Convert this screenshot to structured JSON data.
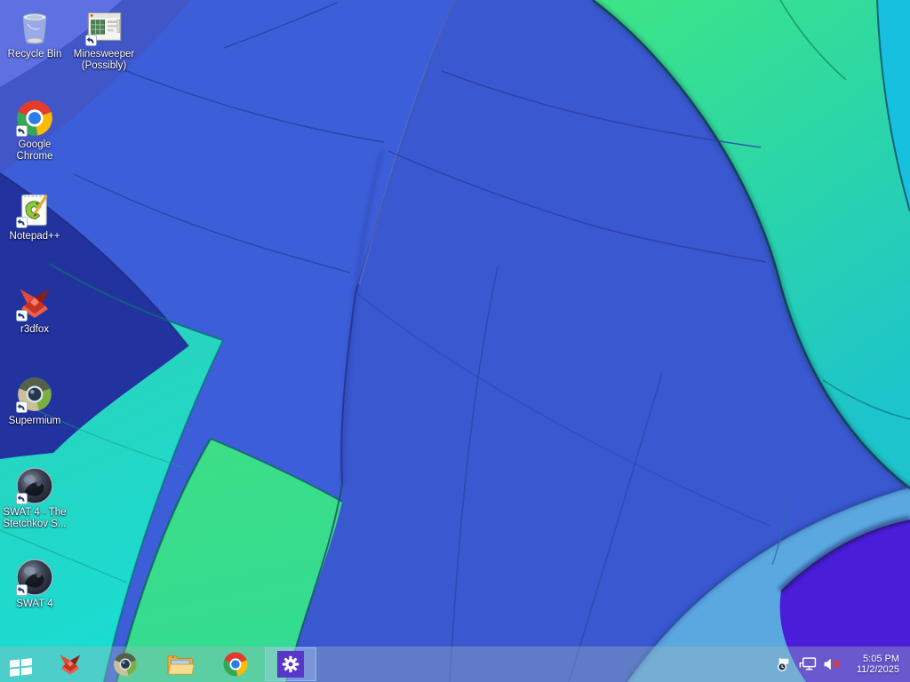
{
  "desktop": {
    "icons": [
      {
        "id": "recycle-bin",
        "label": "Recycle Bin",
        "has_shortcut_arrow": false
      },
      {
        "id": "minesweeper",
        "label": "Minesweeper (Possibly)",
        "has_shortcut_arrow": true
      },
      {
        "id": "google-chrome",
        "label": "Google Chrome",
        "has_shortcut_arrow": true
      },
      {
        "id": "notepad-plus-plus",
        "label": "Notepad++",
        "has_shortcut_arrow": true
      },
      {
        "id": "r3dfox",
        "label": "r3dfox",
        "has_shortcut_arrow": true
      },
      {
        "id": "supermium",
        "label": "Supermium",
        "has_shortcut_arrow": true
      },
      {
        "id": "swat4-stetchkov",
        "label": "SWAT 4 - The Stetchkov S...",
        "has_shortcut_arrow": true
      },
      {
        "id": "swat4",
        "label": "SWAT 4",
        "has_shortcut_arrow": true
      }
    ]
  },
  "taskbar": {
    "buttons": [
      {
        "id": "start",
        "icon": "windows-start-icon",
        "active": false
      },
      {
        "id": "r3dfox",
        "icon": "r3dfox-icon",
        "active": false
      },
      {
        "id": "supermium",
        "icon": "supermium-icon",
        "active": false
      },
      {
        "id": "file-explorer",
        "icon": "file-explorer-icon",
        "active": false
      },
      {
        "id": "google-chrome",
        "icon": "chrome-icon",
        "active": false
      },
      {
        "id": "settings",
        "icon": "settings-gear-icon",
        "active": true
      }
    ],
    "tray": {
      "icons": [
        "action-center-flag-icon",
        "network-wired-icon",
        "volume-muted-icon"
      ],
      "time": "5:05 PM",
      "date": "11/2/2025"
    }
  },
  "colors": {
    "settings_tile": "#5836c9",
    "active_button_highlight": "rgba(190,220,250,0.28)",
    "label_text": "#ffffff",
    "wallpaper_palette": [
      "#3c5fd9",
      "#3a58d0",
      "#5e70e2",
      "#4157c8",
      "#22339f",
      "#2ed0b4",
      "#3ddf86",
      "#3ce487",
      "#1dc4cb",
      "#5ba8e0",
      "#4a1ed8",
      "#17c0de"
    ]
  }
}
